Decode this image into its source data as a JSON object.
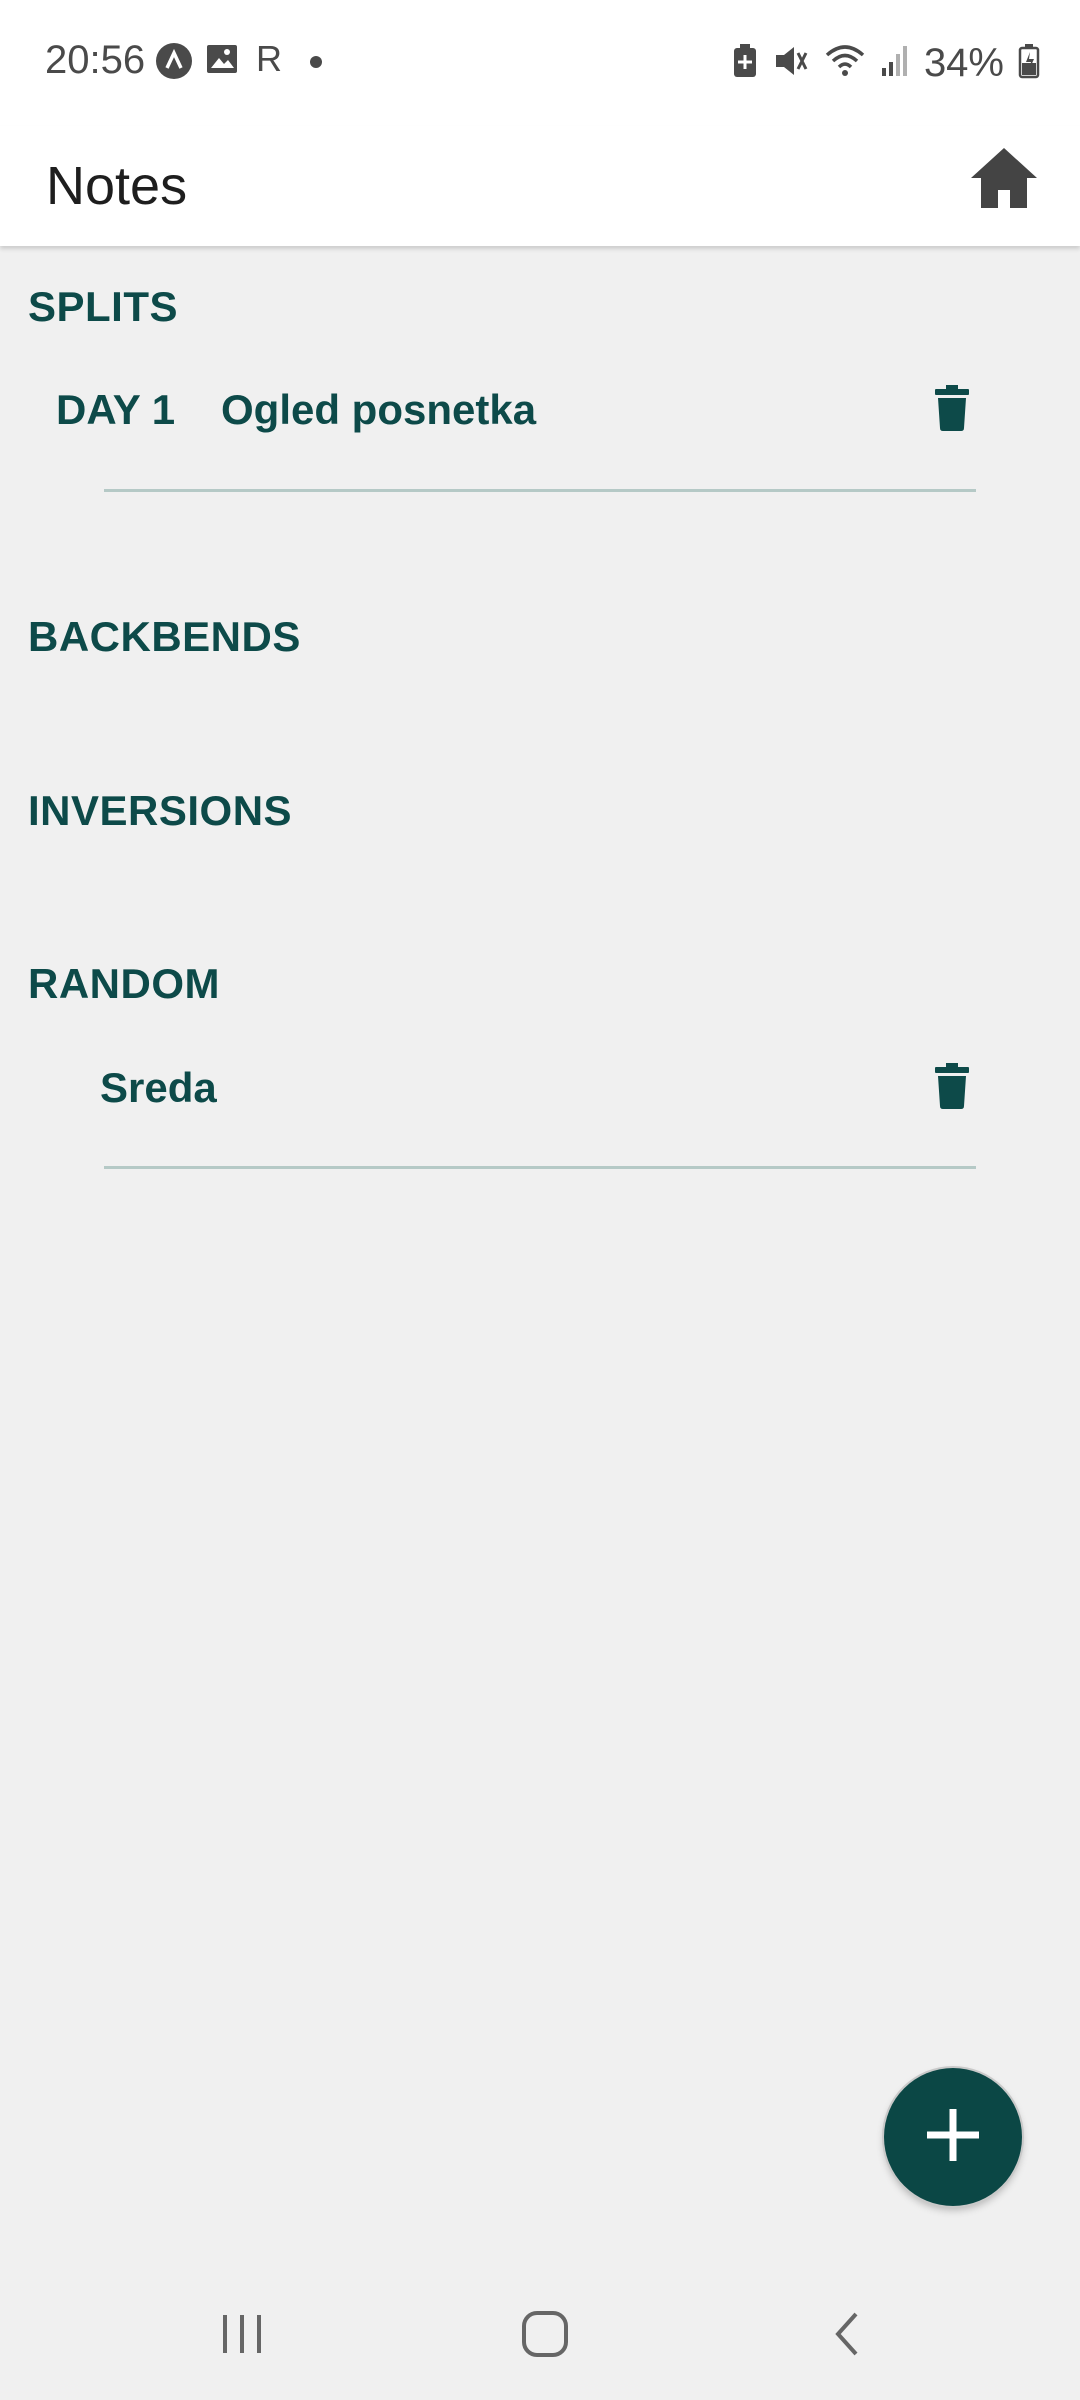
{
  "status_bar": {
    "time": "20:56",
    "r_label": "R",
    "battery_percent": "34%"
  },
  "app_bar": {
    "title": "Notes",
    "home_icon": "home-icon"
  },
  "sections": [
    {
      "title": "SPLITS",
      "notes": [
        {
          "label": "DAY 1",
          "title": "Ogled posnetka",
          "delete_icon": "trash-icon"
        }
      ]
    },
    {
      "title": "BACKBENDS",
      "notes": []
    },
    {
      "title": "INVERSIONS",
      "notes": []
    },
    {
      "title": "RANDOM",
      "notes": [
        {
          "label": "",
          "title": "Sreda",
          "delete_icon": "trash-icon"
        }
      ]
    }
  ],
  "fab": {
    "icon": "plus-icon"
  },
  "nav_bar": {
    "recent_icon": "recent-apps-icon",
    "home_icon": "home-circle-icon",
    "back_icon": "back-icon"
  },
  "colors": {
    "accent": "#0d4a49",
    "fab": "#0b4745",
    "divider": "#b5c9c6",
    "background": "#f0f0f0"
  }
}
